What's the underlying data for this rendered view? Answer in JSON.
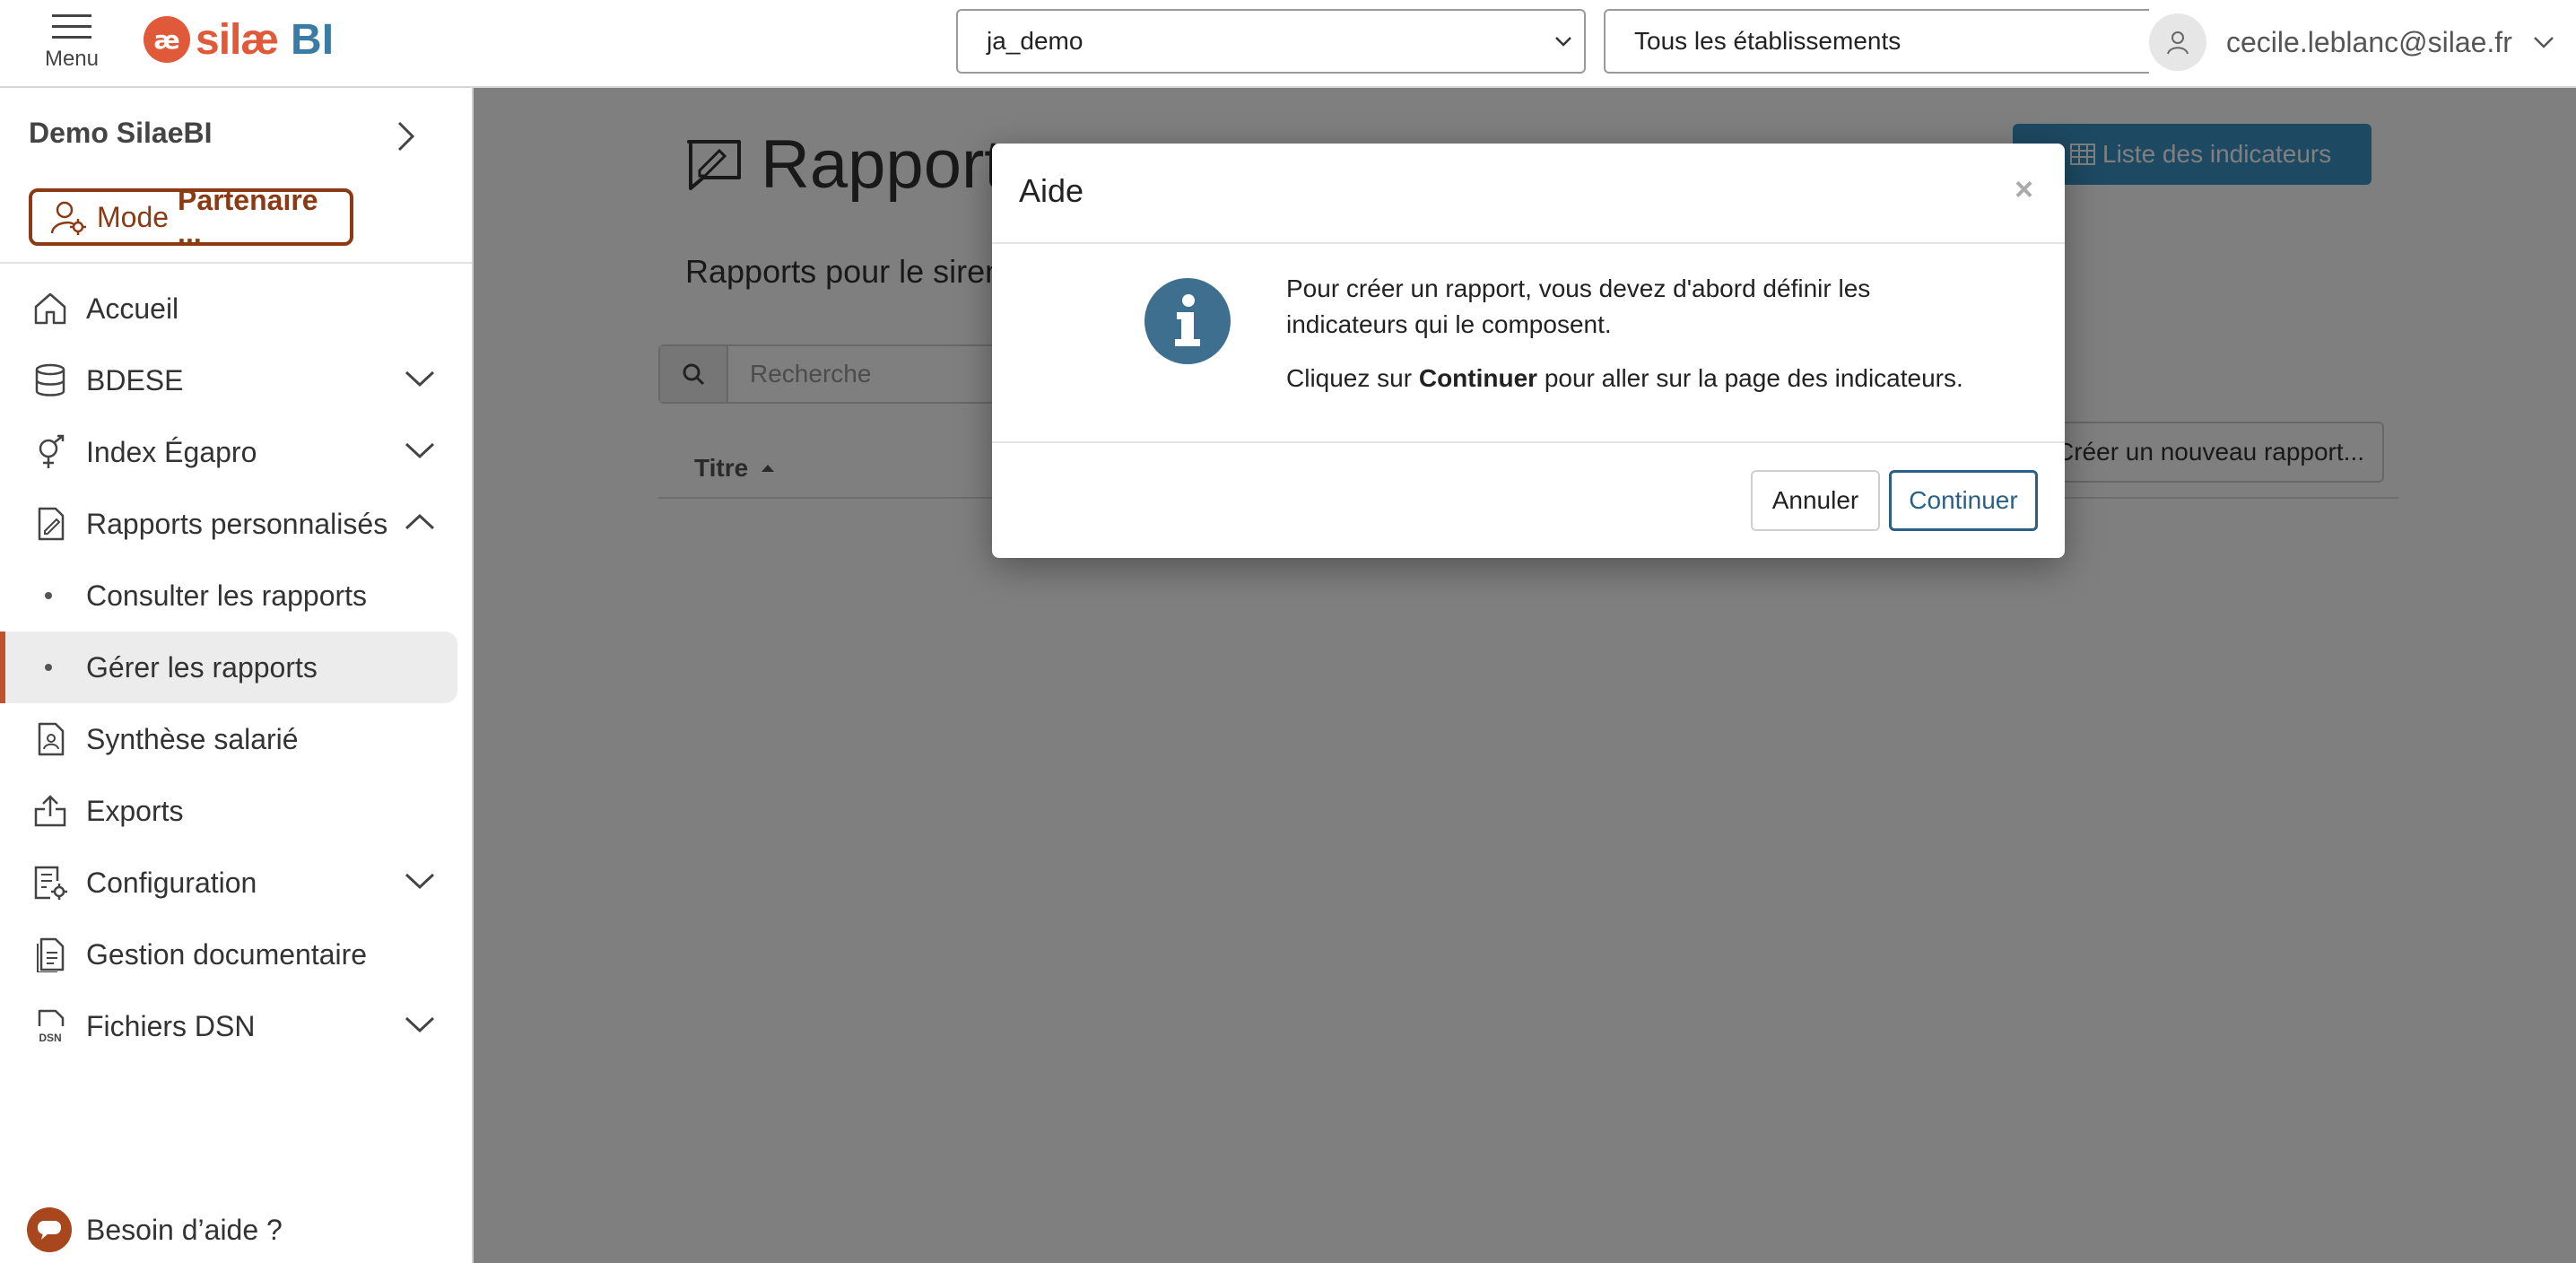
{
  "app": {
    "menu_label": "Menu",
    "logo_name": "silæ",
    "logo_suffix": "BI",
    "logo_mark": "æ",
    "brand_color": "#e05a3a",
    "accent_color": "#3a7ca5"
  },
  "header": {
    "database_select": "ja_demo",
    "establishment_select": "Tous les établissements",
    "user_email": "cecile.leblanc@silae.fr"
  },
  "sidebar": {
    "org_name": "Demo SilaeBI",
    "mode_prefix": "Mode",
    "mode_value": "Partenaire ...",
    "items": [
      {
        "label": "Accueil",
        "icon": "home-icon"
      },
      {
        "label": "BDESE",
        "icon": "database-icon",
        "expandable": true
      },
      {
        "label": "Index Égapro",
        "icon": "gender-icon",
        "expandable": true
      },
      {
        "label": "Rapports personnalisés",
        "icon": "report-edit-icon",
        "expanded": true
      },
      {
        "label": "Consulter les rapports",
        "sub": true
      },
      {
        "label": "Gérer les rapports",
        "sub": true,
        "active": true
      },
      {
        "label": "Synthèse salarié",
        "icon": "employee-file-icon"
      },
      {
        "label": "Exports",
        "icon": "upload-icon"
      },
      {
        "label": "Configuration",
        "icon": "config-icon",
        "expandable": true
      },
      {
        "label": "Gestion documentaire",
        "icon": "document-icon"
      },
      {
        "label": "Fichiers DSN",
        "icon": "dsn-file-icon",
        "expandable": true
      }
    ],
    "help_label": "Besoin d’aide ?"
  },
  "main": {
    "title": "Rapports",
    "subtitle": "Rapports pour le siren",
    "list_button": "Liste des indicateurs",
    "search_placeholder": "Recherche",
    "column_title": "Titre",
    "new_report_button": "Créer un nouveau rapport..."
  },
  "modal": {
    "title": "Aide",
    "close": "×",
    "line1": "Pour créer un rapport, vous devez d'abord définir les indicateurs qui le composent.",
    "line2_prefix": "Cliquez sur",
    "line2_bold": "Continuer",
    "line2_suffix": "pour aller sur la page des indicateurs.",
    "cancel_label": "Annuler",
    "continue_label": "Continuer"
  }
}
